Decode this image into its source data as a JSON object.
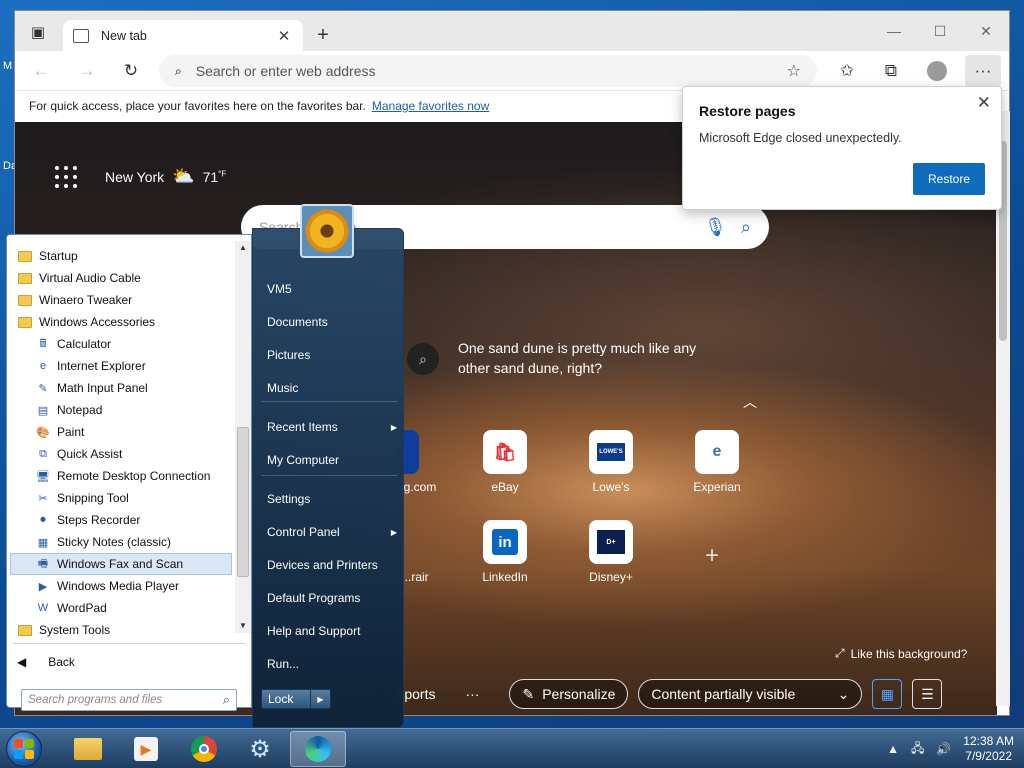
{
  "desktop": {
    "label_1": "M",
    "label_2": "Da"
  },
  "browser": {
    "tab_title": "New tab",
    "address_placeholder": "Search or enter web address",
    "favbar_text": "For quick access, place your favorites here on the favorites bar.",
    "favbar_link": "Manage favorites now"
  },
  "ntp": {
    "city": "New York",
    "temperature": "71",
    "temp_unit": "°F",
    "search_placeholder": "Search the web",
    "quote": "One sand dune is pretty much like any other sand dune, right?",
    "tiles": [
      "...g.com",
      "eBay",
      "Lowe's",
      "Experian",
      "...rair",
      "LinkedIn",
      "Disney+"
    ],
    "like_background": "Like this background?",
    "sports": "Sports",
    "personalize": "Personalize",
    "content_visible": "Content partially visible"
  },
  "restore": {
    "title": "Restore pages",
    "message": "Microsoft Edge closed unexpectedly.",
    "button": "Restore"
  },
  "startmenu": {
    "programs": [
      {
        "label": "Startup",
        "icon": "folder-icon"
      },
      {
        "label": "Virtual Audio Cable",
        "icon": "folder-icon"
      },
      {
        "label": "Winaero Tweaker",
        "icon": "folder-icon"
      },
      {
        "label": "Windows Accessories",
        "icon": "folder-icon"
      },
      {
        "label": "Calculator",
        "icon": "calculator-icon"
      },
      {
        "label": "Internet Explorer",
        "icon": "ie-icon"
      },
      {
        "label": "Math Input Panel",
        "icon": "math-input-icon"
      },
      {
        "label": "Notepad",
        "icon": "notepad-icon"
      },
      {
        "label": "Paint",
        "icon": "paint-icon"
      },
      {
        "label": "Quick Assist",
        "icon": "quick-assist-icon"
      },
      {
        "label": "Remote Desktop Connection",
        "icon": "remote-desktop-icon"
      },
      {
        "label": "Snipping Tool",
        "icon": "scissors-icon"
      },
      {
        "label": "Steps Recorder",
        "icon": "steps-recorder-icon"
      },
      {
        "label": "Sticky Notes (classic)",
        "icon": "sticky-notes-icon"
      },
      {
        "label": "Windows Fax and Scan",
        "icon": "fax-icon"
      },
      {
        "label": "Windows Media Player",
        "icon": "media-player-icon"
      },
      {
        "label": "WordPad",
        "icon": "wordpad-icon"
      },
      {
        "label": "System Tools",
        "icon": "folder-icon"
      }
    ],
    "back": "Back",
    "search_placeholder": "Search programs and files",
    "right_items": [
      "VM5",
      "Documents",
      "Pictures",
      "Music",
      "Recent Items",
      "My Computer",
      "Settings",
      "Control Panel",
      "Devices and Printers",
      "Default Programs",
      "Help and Support",
      "Run..."
    ],
    "lock": "Lock"
  },
  "taskbar": {
    "time": "12:38 AM",
    "date": "7/9/2022"
  }
}
